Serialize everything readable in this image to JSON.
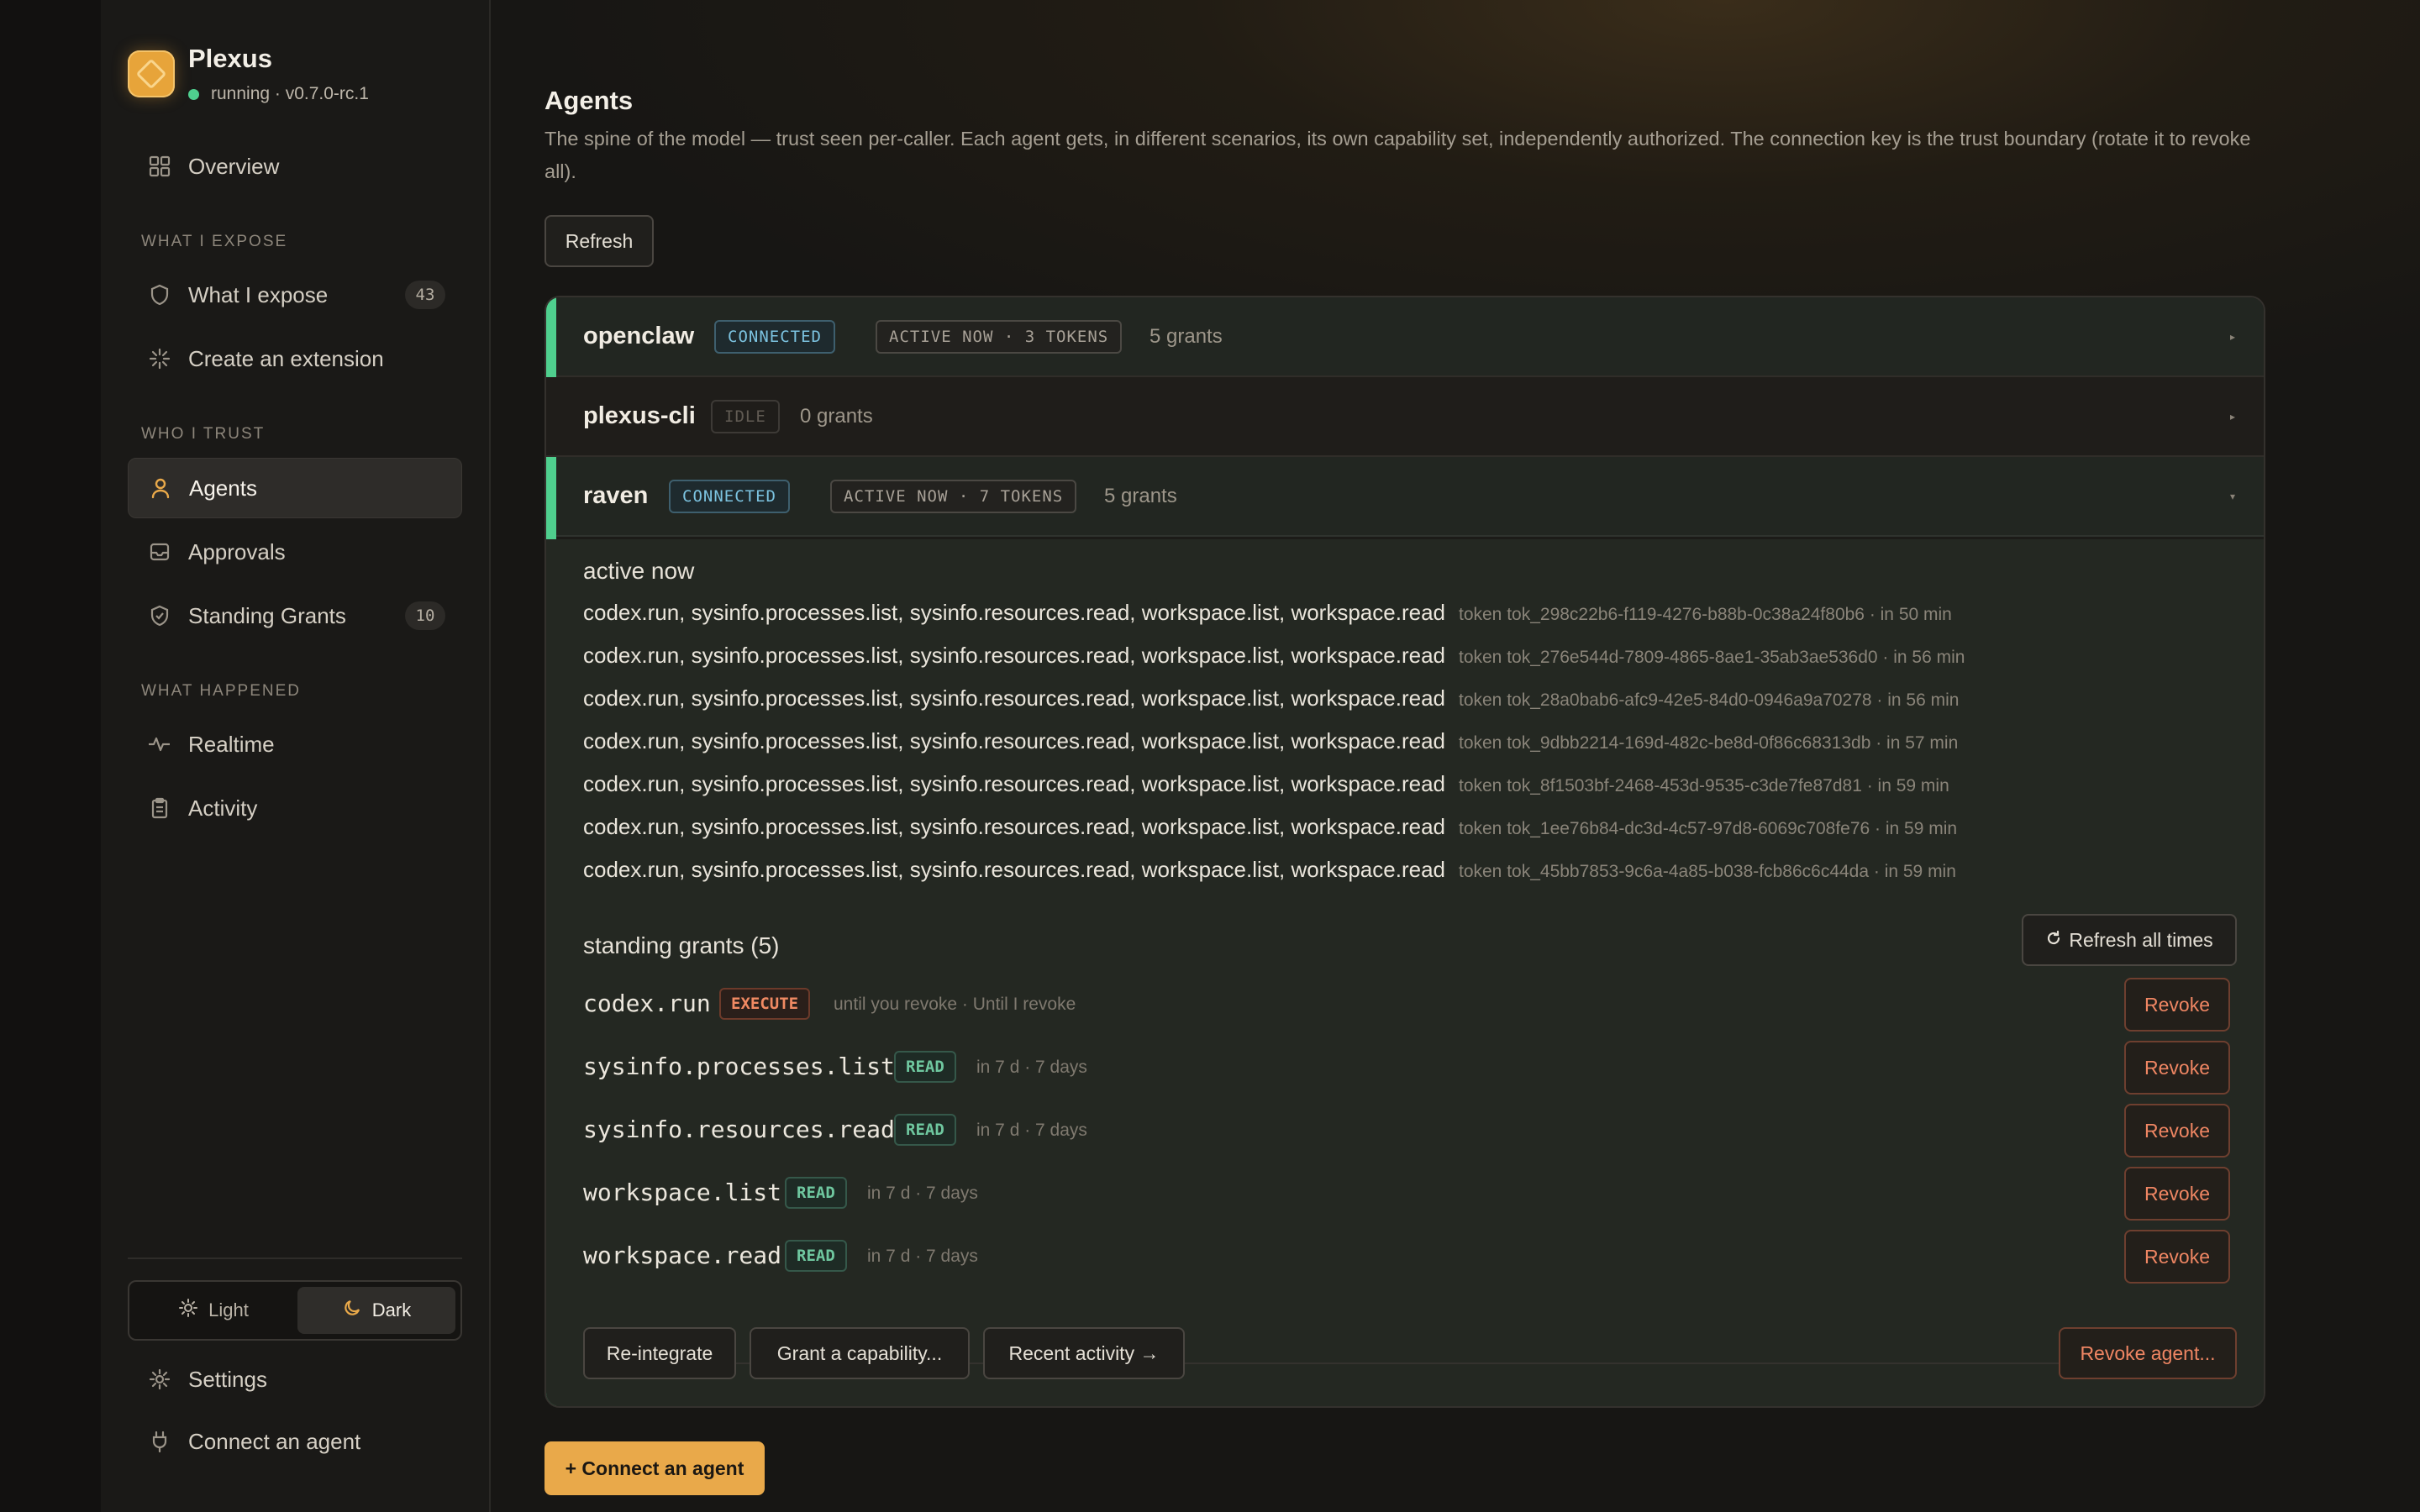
{
  "brand": {
    "name": "Plexus",
    "status": "running · v0.7.0-rc.1"
  },
  "sidebar": {
    "overview": "Overview",
    "sections": {
      "expose": "WHAT I EXPOSE",
      "trust": "WHO I TRUST",
      "happened": "WHAT HAPPENED"
    },
    "what_i_expose": {
      "label": "What I expose",
      "count": "43"
    },
    "create_extension": "Create an extension",
    "agents": "Agents",
    "approvals": "Approvals",
    "standing_grants": {
      "label": "Standing Grants",
      "count": "10"
    },
    "realtime": "Realtime",
    "activity": "Activity",
    "theme": {
      "light": "Light",
      "dark": "Dark"
    },
    "settings": "Settings",
    "connect_agent": "Connect an agent"
  },
  "page": {
    "title": "Agents",
    "description": "The spine of the model — trust seen per-caller. Each agent gets, in different scenarios, its own capability set, independently authorized. The connection key is the trust boundary (rotate it to revoke all).",
    "refresh": "Refresh",
    "connect_button": "+ Connect an agent"
  },
  "agents": [
    {
      "name": "openclaw",
      "status": "CONNECTED",
      "activity": "ACTIVE NOW · 3 TOKENS",
      "grants": "5 grants"
    },
    {
      "name": "plexus-cli",
      "status": "IDLE",
      "grants": "0 grants"
    },
    {
      "name": "raven",
      "status": "CONNECTED",
      "activity": "ACTIVE NOW · 7 TOKENS",
      "grants": "5 grants"
    }
  ],
  "raven": {
    "active_title": "active now",
    "sessions": [
      {
        "caps": "codex.run, sysinfo.processes.list, sysinfo.resources.read, workspace.list, workspace.read",
        "token": "token tok_298c22b6-f119-4276-b88b-0c38a24f80b6 · in 50 min"
      },
      {
        "caps": "codex.run, sysinfo.processes.list, sysinfo.resources.read, workspace.list, workspace.read",
        "token": "token tok_276e544d-7809-4865-8ae1-35ab3ae536d0 · in 56 min"
      },
      {
        "caps": "codex.run, sysinfo.processes.list, sysinfo.resources.read, workspace.list, workspace.read",
        "token": "token tok_28a0bab6-afc9-42e5-84d0-0946a9a70278 · in 56 min"
      },
      {
        "caps": "codex.run, sysinfo.processes.list, sysinfo.resources.read, workspace.list, workspace.read",
        "token": "token tok_9dbb2214-169d-482c-be8d-0f86c68313db · in 57 min"
      },
      {
        "caps": "codex.run, sysinfo.processes.list, sysinfo.resources.read, workspace.list, workspace.read",
        "token": "token tok_8f1503bf-2468-453d-9535-c3de7fe87d81 · in 59 min"
      },
      {
        "caps": "codex.run, sysinfo.processes.list, sysinfo.resources.read, workspace.list, workspace.read",
        "token": "token tok_1ee76b84-dc3d-4c57-97d8-6069c708fe76 · in 59 min"
      },
      {
        "caps": "codex.run, sysinfo.processes.list, sysinfo.resources.read, workspace.list, workspace.read",
        "token": "token tok_45bb7853-9c6a-4a85-b038-fcb86c6c44da · in 59 min"
      }
    ],
    "grants_title": "standing grants (5)",
    "refresh_all": "Refresh all times",
    "grants": [
      {
        "name": "codex.run",
        "perm": "EXECUTE",
        "expiry": "until you revoke · Until I revoke",
        "revoke": "Revoke"
      },
      {
        "name": "sysinfo.processes.list",
        "perm": "READ",
        "expiry": "in 7 d · 7 days",
        "revoke": "Revoke"
      },
      {
        "name": "sysinfo.resources.read",
        "perm": "READ",
        "expiry": "in 7 d · 7 days",
        "revoke": "Revoke"
      },
      {
        "name": "workspace.list",
        "perm": "READ",
        "expiry": "in 7 d · 7 days",
        "revoke": "Revoke"
      },
      {
        "name": "workspace.read",
        "perm": "READ",
        "expiry": "in 7 d · 7 days",
        "revoke": "Revoke"
      }
    ],
    "actions": {
      "reintegrate": "Re-integrate",
      "grant": "Grant a capability...",
      "recent": "Recent activity →",
      "revoke_agent": "Revoke agent..."
    }
  },
  "colors": {
    "accent": "#e9a94a",
    "connected": "#7cc3e0",
    "read": "#6fc79f",
    "execute": "#f08a63",
    "status_ok": "#4fcf8e"
  },
  "icons": [
    "grid-icon",
    "shield-icon",
    "sparkle-icon",
    "person-icon",
    "inbox-icon",
    "shield-check-icon",
    "pulse-icon",
    "clipboard-icon",
    "sun-icon",
    "moon-icon",
    "gear-icon",
    "plug-icon",
    "refresh-icon",
    "chevron-icon"
  ]
}
